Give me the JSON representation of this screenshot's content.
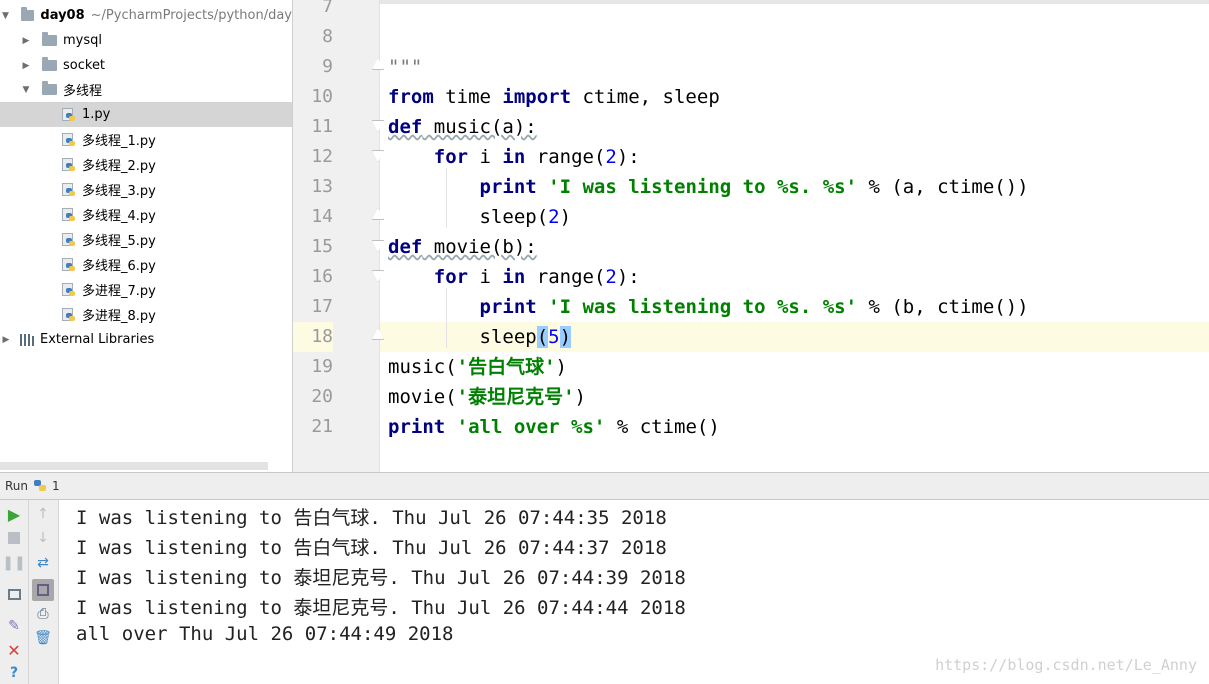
{
  "project": {
    "root_name": "day08",
    "root_path": "~/PycharmProjects/python/day",
    "items": [
      {
        "label": "mysql",
        "type": "folder",
        "expanded": false,
        "indent": 1
      },
      {
        "label": "socket",
        "type": "folder",
        "expanded": false,
        "indent": 1
      },
      {
        "label": "多线程",
        "type": "folder",
        "expanded": true,
        "indent": 1
      },
      {
        "label": "1.py",
        "type": "python-file",
        "selected": true,
        "indent": 2
      },
      {
        "label": "多线程_1.py",
        "type": "python-file",
        "indent": 2
      },
      {
        "label": "多线程_2.py",
        "type": "python-file",
        "indent": 2
      },
      {
        "label": "多线程_3.py",
        "type": "python-file",
        "indent": 2
      },
      {
        "label": "多线程_4.py",
        "type": "python-file",
        "indent": 2
      },
      {
        "label": "多线程_5.py",
        "type": "python-file",
        "indent": 2
      },
      {
        "label": "多线程_6.py",
        "type": "python-file",
        "indent": 2
      },
      {
        "label": "多进程_7.py",
        "type": "python-file",
        "indent": 2
      },
      {
        "label": "多进程_8.py",
        "type": "python-file",
        "indent": 2
      }
    ],
    "external_libraries": "External Libraries"
  },
  "editor": {
    "line_numbers": [
      "7",
      "8",
      "9",
      "10",
      "11",
      "12",
      "13",
      "14",
      "15",
      "16",
      "17",
      "18",
      "19",
      "20",
      "21"
    ],
    "current_line": "18",
    "code": {
      "l9": "\"\"\"",
      "l10_kw1": "from",
      "l10_mid": " time ",
      "l10_kw2": "import",
      "l10_rest": " ctime, sleep",
      "l11_kw": "def",
      "l11_rest": " music(a):",
      "l12_kw1": "for",
      "l12_mid": " i ",
      "l12_kw2": "in",
      "l12_fn": " range(",
      "l12_num": "2",
      "l12_end": "):",
      "l13_kw": "print",
      "l13_str": "'I was listening to %s. %s'",
      "l13_rest": " % (a, ctime())",
      "l14_fn": "sleep(",
      "l14_num": "2",
      "l14_end": ")",
      "l15_kw": "def",
      "l15_rest": " movie(b):",
      "l16_kw1": "for",
      "l16_mid": " i ",
      "l16_kw2": "in",
      "l16_fn": " range(",
      "l16_num": "2",
      "l16_end": "):",
      "l17_kw": "print",
      "l17_str": "'I was listening to %s. %s'",
      "l17_rest": " % (b, ctime())",
      "l18_fn": "sleep",
      "l18_p1": "(",
      "l18_num": "5",
      "l18_p2": ")",
      "l19_fn": "music(",
      "l19_str": "'告白气球'",
      "l19_end": ")",
      "l20_fn": "movie(",
      "l20_str": "'泰坦尼克号'",
      "l20_end": ")",
      "l21_kw": "print",
      "l21_str": "'all over %s'",
      "l21_rest": " % ctime()"
    }
  },
  "run": {
    "label": "Run",
    "config_name": "1",
    "output": [
      "I was listening to 告白气球. Thu Jul 26 07:44:35 2018",
      "I was listening to 告白气球. Thu Jul 26 07:44:37 2018",
      "I was listening to 泰坦尼克号. Thu Jul 26 07:44:39 2018",
      "I was listening to 泰坦尼克号. Thu Jul 26 07:44:44 2018",
      "all over Thu Jul 26 07:44:49 2018"
    ],
    "tools_left": [
      "rerun-icon",
      "stop-icon",
      "pause-icon",
      "layout-icon",
      "pin-icon",
      "close-icon",
      "help-icon"
    ],
    "tools_right": [
      "up-arrow-icon",
      "down-arrow-icon",
      "soft-wrap-icon",
      "scroll-to-end-icon",
      "print-icon",
      "trash-icon"
    ]
  },
  "watermark": "https://blog.csdn.net/Le_Anny",
  "colors": {
    "keyword": "#000080",
    "string": "#008000",
    "number": "#0000ff",
    "selected_row": "#d5d5d5",
    "caret_line": "#fdfbe1",
    "run_green": "#3aa63a",
    "close_red": "#d9403a",
    "help_blue": "#3f87c6"
  }
}
